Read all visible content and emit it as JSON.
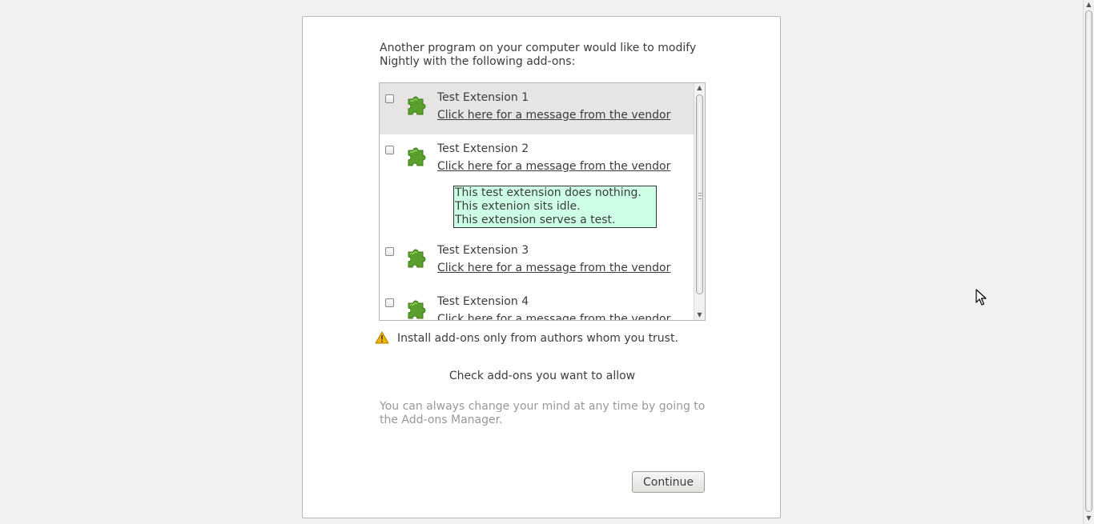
{
  "dialog": {
    "intro_text": "Another program on your computer would like to modify Nightly with the following add-ons:",
    "addons": [
      {
        "name": "Test Extension 1",
        "vendor_link": "Click here for a message from the vendor",
        "checked": false,
        "icon": "puzzle-piece-icon"
      },
      {
        "name": "Test Extension 2",
        "vendor_link": "Click here for a message from the vendor",
        "checked": false,
        "icon": "puzzle-piece-icon"
      },
      {
        "name": "Test Extension 3",
        "vendor_link": "Click here for a message from the vendor",
        "checked": false,
        "icon": "puzzle-piece-icon"
      },
      {
        "name": "Test Extension 4",
        "vendor_link": "Click here for a message from the vendor",
        "checked": false,
        "icon": "puzzle-piece-icon"
      }
    ],
    "vendor_message": {
      "lines": [
        "This test extension does nothing.",
        "This extenion sits idle.",
        "This extension serves a test."
      ],
      "background": "#ccffe5"
    },
    "warning_text": "Install add-ons only from authors whom you trust.",
    "check_label": "Check add-ons you want to allow",
    "note_text": "You can always change your mind at any time by going to the Add-ons Manager.",
    "continue_label": "Continue"
  },
  "colors": {
    "page_background": "#f2f1f0",
    "selected_row": "#e6e5e3",
    "puzzle_green": "#5aa02c",
    "warning_yellow": "#f0b400"
  }
}
